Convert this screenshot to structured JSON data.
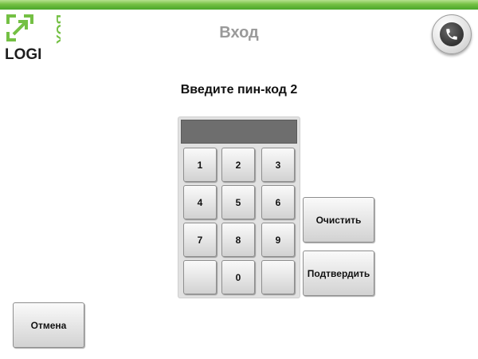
{
  "header": {
    "title": "Вход",
    "logo": {
      "text_left": "LOGI",
      "text_right": "BOX"
    },
    "phone_icon": "phone-icon"
  },
  "prompt": "Введите пин-код 2",
  "pin_display": {
    "value": ""
  },
  "keypad": {
    "key_1": "1",
    "key_2": "2",
    "key_3": "3",
    "key_4": "4",
    "key_5": "5",
    "key_6": "6",
    "key_7": "7",
    "key_8": "8",
    "key_9": "9",
    "key_blank_left": "",
    "key_0": "0",
    "key_blank_right": ""
  },
  "actions": {
    "clear_label": "Очистить",
    "confirm_label": "Подтвердить",
    "cancel_label": "Отмена"
  },
  "colors": {
    "brand_green": "#74c044",
    "logo_text": "#1e1e1e",
    "title_gray": "#9a9a9a",
    "display_gray": "#6e6e6e"
  }
}
